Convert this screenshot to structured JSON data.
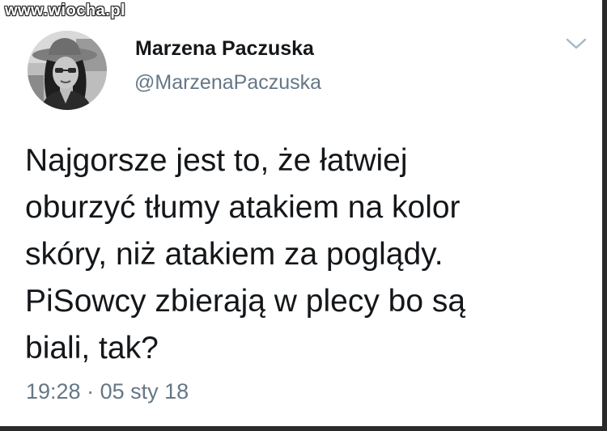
{
  "watermark": "www.wiocha.pl",
  "author": {
    "display_name": "Marzena Paczuska",
    "handle": "@MarzenaPaczuska"
  },
  "tweet": {
    "lines": [
      "Najgorsze jest to, że łatwiej",
      "oburzyć tłumy atakiem na kolor",
      "skóry, niż atakiem za poglądy.",
      "PiSowcy zbierają w plecy bo są",
      "biali, tak?"
    ],
    "time": "19:28",
    "separator": "·",
    "date": "05 sty 18"
  },
  "icons": {
    "menu": "chevron-down-icon",
    "avatar": "profile-photo"
  },
  "colors": {
    "text": "#14171a",
    "secondary": "#657786",
    "background": "#ffffff"
  }
}
